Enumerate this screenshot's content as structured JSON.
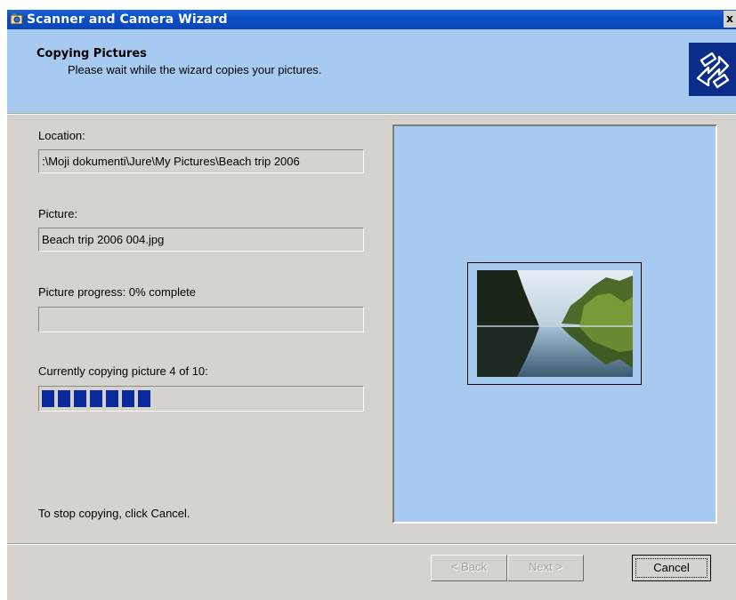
{
  "window": {
    "title": "Scanner and Camera Wizard",
    "close_label": "x"
  },
  "header": {
    "title": "Copying Pictures",
    "subtitle": "Please wait while the wizard copies your pictures."
  },
  "location": {
    "label": "Location:",
    "value": ":\\Moji dokumenti\\Jure\\My Pictures\\Beach trip 2006"
  },
  "picture": {
    "label": "Picture:",
    "value": "Beach trip 2006 004.jpg"
  },
  "picture_progress": {
    "label": "Picture progress: 0% complete",
    "percent": 0
  },
  "overall_progress": {
    "label": "Currently copying picture 4 of 10:",
    "current": 4,
    "total": 10,
    "blocks_filled": 7
  },
  "footer": {
    "stop_text": "To stop copying, click Cancel.",
    "back_label": "< Back",
    "next_label": "Next >",
    "cancel_label": "Cancel"
  },
  "colors": {
    "titlebar": "#0b4fc4",
    "header_bg": "#a6caf0",
    "preview_bg": "#a6caf0",
    "progress_block": "#0a2a9e",
    "window_bg": "#d6d3ce"
  },
  "icons": {
    "title_icon": "scanner-camera-icon",
    "header_logo": "camera-wizard-logo-icon"
  }
}
